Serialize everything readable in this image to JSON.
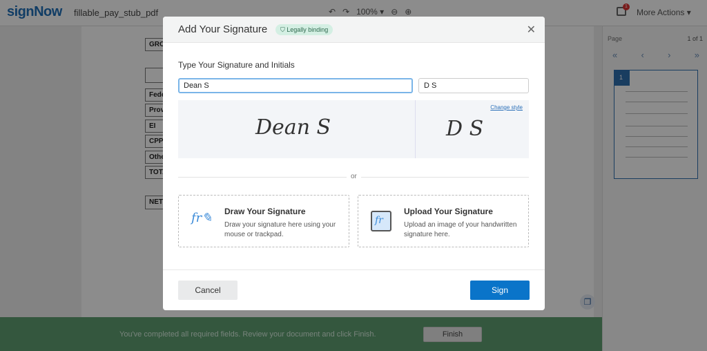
{
  "app": {
    "logo": "signNow",
    "file_name": "fillable_pay_stub_pdf",
    "zoom": "100%",
    "more_actions": "More Actions",
    "notification_count": "1"
  },
  "document": {
    "rows": [
      "GRO",
      "Fede",
      "Prov",
      "EI",
      "CPP",
      "Othe",
      "TOTA",
      "NET"
    ]
  },
  "pages_panel": {
    "label": "Page",
    "count": "1 of 1",
    "thumb_number": "1"
  },
  "status_bar": {
    "message": "You've completed all required fields. Review your document and click Finish.",
    "finish_label": "Finish"
  },
  "modal": {
    "title": "Add Your Signature",
    "badge": "Legally binding",
    "section_title": "Type Your Signature and Initials",
    "signature_value": "Dean S",
    "initials_value": "D S",
    "change_style": "Change style",
    "or": "or",
    "draw": {
      "title": "Draw Your Signature",
      "desc": "Draw your signature here using your mouse or trackpad."
    },
    "upload": {
      "title": "Upload Your Signature",
      "desc": "Upload an image of your handwritten signature here."
    },
    "cancel": "Cancel",
    "sign": "Sign"
  },
  "colors": {
    "brand": "#1f6fb8",
    "primary_button": "#0a74c9",
    "status_bar": "#5f9e72"
  }
}
